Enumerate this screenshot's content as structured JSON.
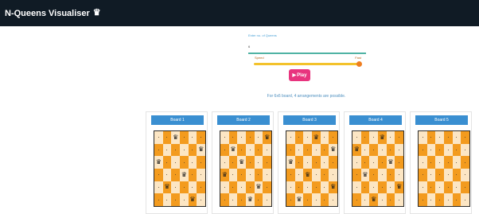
{
  "navbar": {
    "title": "N-Queens Visualiser",
    "title_icon": "crown-icon"
  },
  "controls": {
    "label": "Enter no. of Queens",
    "value": "6",
    "slider_min": "Speed",
    "slider_max": "Fast",
    "slider_level": 1.0
  },
  "play_button": {
    "label": "Play",
    "icon": "play-icon"
  },
  "info_text": "For 6x6 board, 4 arrangements are possible.",
  "colors": {
    "navbar": "#101b25",
    "play": "#e8347e",
    "board_header": "#3a8fd1",
    "light_cell": "#fce6c4",
    "dark_cell": "#f39b1e",
    "slider": "#f3c22b"
  },
  "boards": [
    {
      "title": "Board 1",
      "queens": [
        [
          0,
          2
        ],
        [
          1,
          5
        ],
        [
          2,
          0
        ],
        [
          3,
          3
        ],
        [
          4,
          1
        ],
        [
          5,
          4
        ]
      ]
    },
    {
      "title": "Board 2",
      "queens": [
        [
          0,
          5
        ],
        [
          1,
          1
        ],
        [
          2,
          2
        ],
        [
          3,
          0
        ],
        [
          4,
          4
        ],
        [
          5,
          3
        ]
      ]
    },
    {
      "title": "Board 3",
      "queens": [
        [
          0,
          3
        ],
        [
          1,
          5
        ],
        [
          2,
          0
        ],
        [
          3,
          2
        ],
        [
          4,
          5
        ],
        [
          5,
          1
        ]
      ]
    },
    {
      "title": "Board 4",
      "queens": [
        [
          0,
          3
        ],
        [
          1,
          0
        ],
        [
          2,
          4
        ],
        [
          3,
          1
        ],
        [
          4,
          5
        ],
        [
          5,
          2
        ]
      ]
    },
    {
      "title": "Board 5",
      "queens": []
    }
  ]
}
